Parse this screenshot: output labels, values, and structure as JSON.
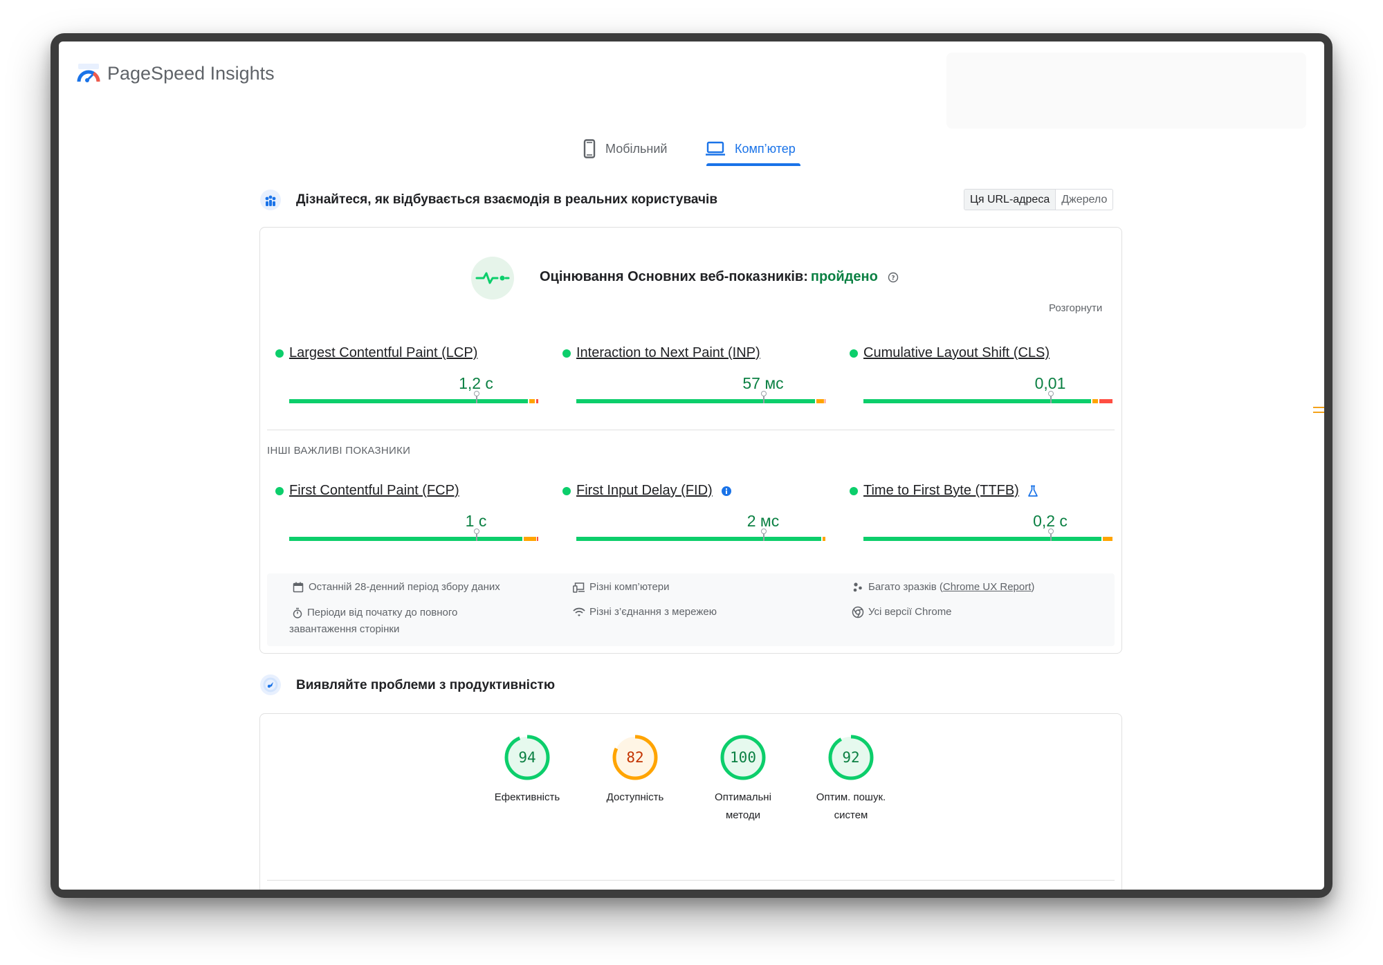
{
  "app": {
    "title": "PageSpeed Insights"
  },
  "tabs": [
    {
      "label": "Мобільний",
      "active": false
    },
    {
      "label": "Комп’ютер",
      "active": true
    }
  ],
  "field": {
    "title": "Дізнайтеся, як відбувається взаємодія в реальних користувачів",
    "toggle": [
      "Ця URL-адреса",
      "Джерело"
    ],
    "assessment_prefix": "Оцінювання Основних веб-показників:",
    "assessment_status": "пройдено",
    "expand_label": "Розгорнути",
    "other_label": "ІНШІ ВАЖЛИВІ ПОКАЗНИКИ",
    "core_metrics": [
      {
        "name": "Largest Contentful Paint (LCP)",
        "value": "1,2 с"
      },
      {
        "name": "Interaction to Next Paint (INP)",
        "value": "57 мс"
      },
      {
        "name": "Cumulative Layout Shift (CLS)",
        "value": "0,01"
      }
    ],
    "other_metrics": [
      {
        "name": "First Contentful Paint (FCP)",
        "value": "1 с"
      },
      {
        "name": "First Input Delay (FID)",
        "value": "2 мс"
      },
      {
        "name": "Time to First Byte (TTFB)",
        "value": "0,2 с"
      }
    ],
    "info": {
      "period": "Останній 28-денний період збору даних",
      "duration": "Періоди від початку до повного завантаження сторінки",
      "devices": "Різні комп’ютери",
      "network": "Різні з’єднання з мережею",
      "samples_prefix": "Багато зразків (",
      "samples_link": "Chrome UX Report",
      "samples_suffix": ")",
      "chrome": "Усі версії Chrome"
    }
  },
  "lab": {
    "title": "Виявляйте проблеми з продуктивністю",
    "scores": [
      {
        "value": "94",
        "label_lines": [
          "Ефективність"
        ],
        "color": "#0cce6b",
        "text_color": "#0b8043",
        "fraction": 0.94
      },
      {
        "value": "82",
        "label_lines": [
          "Доступність"
        ],
        "color": "#ffa400",
        "text_color": "#c33300",
        "fraction": 0.82
      },
      {
        "value": "100",
        "label_lines": [
          "Оптимальні",
          "методи"
        ],
        "color": "#0cce6b",
        "text_color": "#0b8043",
        "fraction": 1.0
      },
      {
        "value": "92",
        "label_lines": [
          "Оптим. пошук.",
          "систем"
        ],
        "color": "#0cce6b",
        "text_color": "#0b8043",
        "fraction": 0.92
      }
    ]
  },
  "colors": {
    "accent": "#1a73e8",
    "good": "#0cce6b",
    "pass_text": "#0b8043",
    "needs_improvement": "#ffa400",
    "poor": "#ff4e42"
  }
}
